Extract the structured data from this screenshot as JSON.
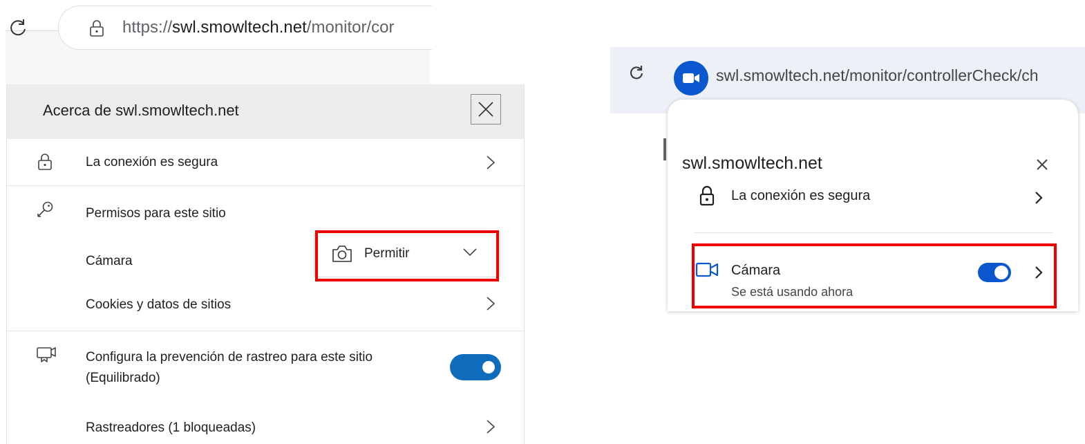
{
  "edge": {
    "url_prefix": "https://",
    "url_domain": "swl.smowltech.net",
    "url_path": "/monitor/cor",
    "panel_title": "Acerca de swl.smowltech.net",
    "connection_label": "La conexión es segura",
    "permissions_heading": "Permisos para este sitio",
    "camera_label": "Cámara",
    "camera_value": "Permitir",
    "cookies_label": "Cookies y datos de sitios",
    "tracking_label_line1": "Configura la prevención de rastreo para este sitio",
    "tracking_label_line2": "(Equilibrado)",
    "tracking_enabled": true,
    "trackers_label": "Rastreadores (1 bloqueadas)"
  },
  "chrome": {
    "url": "swl.smowltech.net/monitor/controllerCheck/ch",
    "panel_title": "swl.smowltech.net",
    "connection_label": "La conexión es segura",
    "camera_label": "Cámara",
    "camera_status": "Se está usando ahora",
    "camera_enabled": true
  },
  "colors": {
    "highlight": "#ee0000",
    "edge_accent": "#0f6cbd",
    "chrome_accent": "#0b57d0"
  }
}
